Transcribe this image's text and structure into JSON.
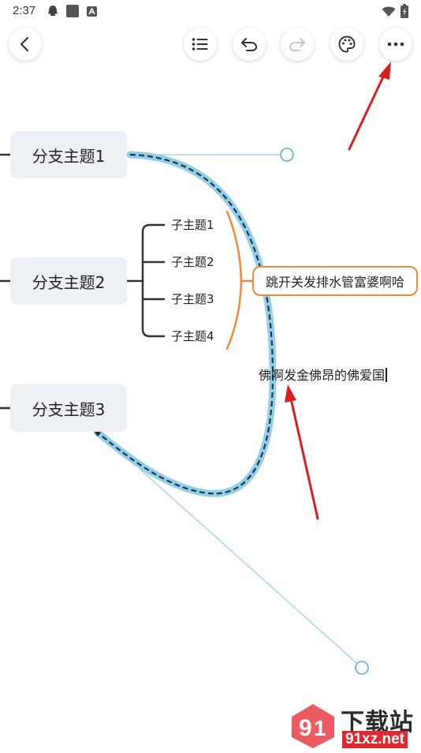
{
  "status_bar": {
    "time": "2:37"
  },
  "toolbar": {
    "back_icon": "chevron-left-icon",
    "outline_icon": "list-icon",
    "undo_icon": "undo-icon",
    "redo_icon": "redo-icon",
    "theme_icon": "palette-icon",
    "more_icon": "more-horizontal-icon"
  },
  "mindmap": {
    "branches": [
      {
        "label": "分支主题1"
      },
      {
        "label": "分支主题2"
      },
      {
        "label": "分支主题3"
      }
    ],
    "subtopics": [
      {
        "label": "子主题1"
      },
      {
        "label": "子主题2"
      },
      {
        "label": "子主题3"
      },
      {
        "label": "子主题4"
      }
    ],
    "summary": {
      "label": "跳开关发排水管富婆啊哈"
    },
    "relationship": {
      "label": "佛啊发金佛昂的佛爱国"
    }
  },
  "colors": {
    "node_bg": "#edf1f5",
    "connector": "#333333",
    "summary_accent": "#f08a3a",
    "relationship_line": "#8fd0ef",
    "control_handle": "#4fb3e6",
    "annotation_arrow": "#d81e1e"
  },
  "watermark": {
    "cn": "下载站",
    "en": "91xz.net"
  }
}
